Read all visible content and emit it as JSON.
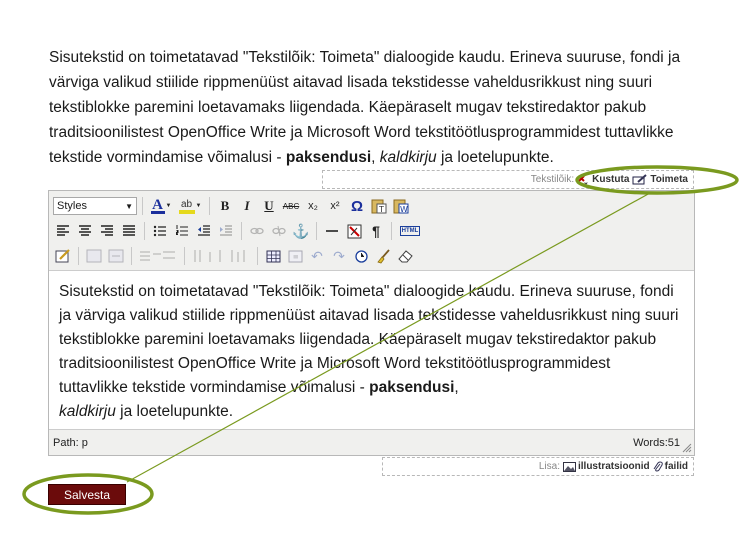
{
  "intro": {
    "text_before": "Sisutekstid on toimetatavad \"Tekstilõik: Toimeta\" dialoogide kaudu. Erineva suuruse, fondi ja värviga valikud stiilide rippmenüüst aitavad lisada tekstidesse vaheldusrikkust ning suuri tekstiblokke paremini loetavamaks liigendada. Käepäraselt mugav tekstiredaktor pakub traditsioonilistest OpenOffice Write ja Microsoft Word tekstitöötlusprogrammidest tuttavlikke tekstide vormindamise võimalusi - ",
    "bold": "paksendusi",
    "comma": ", ",
    "italic": "kaldkirju",
    "text_after": " ja loetelupunkte."
  },
  "paragraph_controls": {
    "label": "Tekstilõik:",
    "delete_label": "Kustuta",
    "edit_label": "Toimeta"
  },
  "editor": {
    "styles_select": "Styles",
    "content": {
      "text_before": "Sisutekstid on toimetatavad \"Tekstilõik: Toimeta\" dialoogide kaudu. Erineva suuruse, fondi ja värviga valikud stiilide rippmenüüst aitavad lisada tekstidesse vaheldusrikkust ning suuri tekstiblokke paremini loetavamaks liigendada. Käepäraselt mugav tekstiredaktor pakub traditsioonilistest OpenOffice Write ja Microsoft Word tekstitöötlusprogrammidest tuttavlikke tekstide vormindamise võimalusi - ",
      "bold": "paksendusi",
      "comma": ",",
      "italic": "kaldkirju",
      "text_after": " ja loetelupunkte."
    },
    "path": "Path: p",
    "words": "Words:51",
    "toolbar_glyphs": {
      "bold": "B",
      "italic": "I",
      "underline": "U",
      "strike": "ABC",
      "sub": "x₂",
      "sup": "x²",
      "omega": "Ω",
      "font_color": "A",
      "highlight": "ab",
      "pilcrow": "¶",
      "html": "HTML"
    }
  },
  "add_controls": {
    "label": "Lisa:",
    "illustrations_label": "illustratsioonid",
    "files_label": "failid"
  },
  "save_button": "Salvesta",
  "colors": {
    "save_bg": "#6b0b0b",
    "highlight_ring": "#7a9a1f",
    "editor_toolbar_bg": "#f0f0ee"
  }
}
